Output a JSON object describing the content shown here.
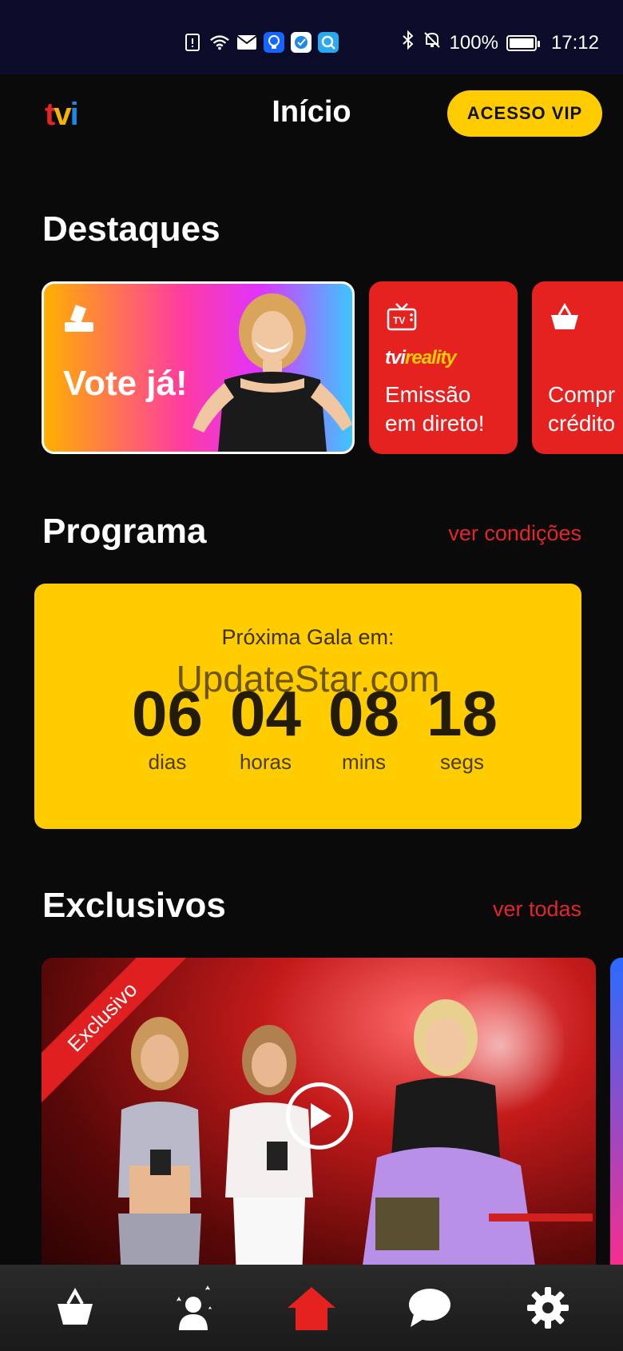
{
  "status_bar": {
    "battery": "100%",
    "time": "17:12",
    "icons": [
      "sim-alert-icon",
      "wifi-icon",
      "mail-icon",
      "bulb-app-icon",
      "vpn-app-icon",
      "search-app-icon",
      "bluetooth-icon",
      "mute-icon",
      "battery-icon"
    ]
  },
  "header": {
    "logo_t": "t",
    "logo_v": "v",
    "logo_i": "i",
    "title": "Início",
    "vip_button": "ACESSO VIP"
  },
  "destaques": {
    "title": "Destaques",
    "cards": [
      {
        "label": "Vote já!",
        "icon": "ballot-icon"
      },
      {
        "logo_a": "tvi",
        "logo_b": "reality",
        "label": "Emissão\nem direto!",
        "icon": "tv-icon"
      },
      {
        "label": "Compr\ncrédito",
        "icon": "basket-icon"
      }
    ]
  },
  "programa": {
    "title": "Programa",
    "link": "ver condições",
    "countdown_label": "Próxima Gala em:",
    "watermark": "UpdateStar.com",
    "units": [
      {
        "value": "06",
        "caption": "dias"
      },
      {
        "value": "04",
        "caption": "horas"
      },
      {
        "value": "08",
        "caption": "mins"
      },
      {
        "value": "18",
        "caption": "segs"
      }
    ]
  },
  "exclusivos": {
    "title": "Exclusivos",
    "link": "ver todas",
    "ribbon": "Exclusivo"
  },
  "nav": {
    "items": [
      "basket-icon",
      "stars-person-icon",
      "home-icon",
      "chat-icon",
      "gear-icon"
    ],
    "active": "home-icon",
    "colors": {
      "active": "#e52220",
      "inactive": "#ffffff"
    }
  },
  "colors": {
    "accent": "#ffcc00",
    "red": "#e52220",
    "background": "#0a0a0a"
  }
}
